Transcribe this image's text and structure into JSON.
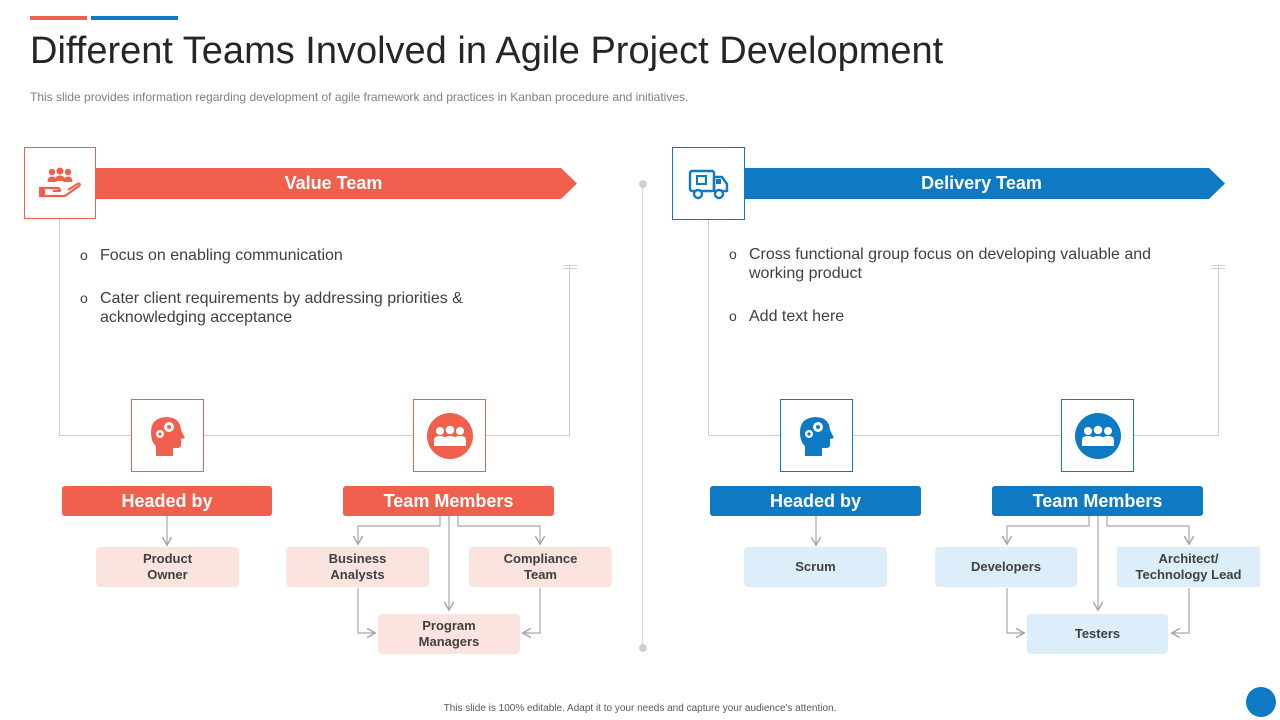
{
  "header": {
    "title": "Different Teams Involved in Agile Project Development",
    "subtitle": "This slide provides  information  regarding  development  of agile framework  and  practices  in Kanban procedure  and initiatives."
  },
  "colors": {
    "red": "#f0604c",
    "blue": "#0e7ac4"
  },
  "value_team": {
    "banner": "Value Team",
    "banner_icon": "hand-holding-people-icon",
    "bullets": [
      "Focus on enabling communication",
      "Cater client requirements  by addressing priorities & acknowledging acceptance"
    ],
    "headed_by": {
      "label": "Headed by",
      "icon": "head-gears-icon"
    },
    "team_members": {
      "label": "Team Members",
      "icon": "group-icon"
    },
    "nodes": {
      "product_owner": "Product Owner",
      "business_analysts": "Business Analysts",
      "compliance_team": "Compliance Team",
      "program_managers": "Program Managers"
    }
  },
  "delivery_team": {
    "banner": "Delivery Team",
    "banner_icon": "delivery-truck-icon",
    "bullets": [
      "Cross functional  group focus  on developing valuable  and working product",
      "Add text here"
    ],
    "headed_by": {
      "label": "Headed by",
      "icon": "head-gears-icon"
    },
    "team_members": {
      "label": "Team Members",
      "icon": "group-icon"
    },
    "nodes": {
      "scrum": "Scrum",
      "developers": "Developers",
      "architect": "Architect/ Technology Lead",
      "testers": "Testers"
    }
  },
  "footer": {
    "text": "This slide is 100% editable.  Adapt it to your needs and capture your audience's attention."
  },
  "bullet_marker": "o"
}
